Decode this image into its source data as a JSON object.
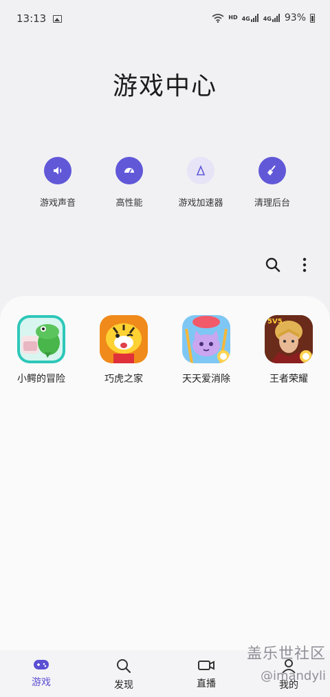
{
  "status_bar": {
    "time": "13:13",
    "hd": "HD",
    "network1": "4G",
    "network2": "4G",
    "battery": "93%"
  },
  "title": "游戏中心",
  "quick_actions": [
    {
      "label": "游戏声音",
      "icon": "volume-icon"
    },
    {
      "label": "高性能",
      "icon": "performance-icon"
    },
    {
      "label": "游戏加速器",
      "icon": "accelerator-icon"
    },
    {
      "label": "清理后台",
      "icon": "broom-icon"
    }
  ],
  "games": [
    {
      "name": "小鳄的冒险",
      "icon": "crocodile-game-icon"
    },
    {
      "name": "巧虎之家",
      "icon": "tiger-game-icon"
    },
    {
      "name": "天天爱消除",
      "icon": "cat-game-icon"
    },
    {
      "name": "王者荣耀",
      "icon": "hero-game-icon",
      "badge": "5V5"
    }
  ],
  "bottom_nav": [
    {
      "label": "游戏",
      "icon": "gamepad-icon",
      "active": true
    },
    {
      "label": "发现",
      "icon": "search-icon",
      "active": false
    },
    {
      "label": "直播",
      "icon": "video-camera-icon",
      "active": false
    },
    {
      "label": "我的",
      "icon": "person-icon",
      "active": false
    }
  ],
  "watermark": {
    "line1": "盖乐世社区",
    "line2": "@imandyli"
  },
  "colors": {
    "accent": "#6158d8",
    "background": "#f1f1f3",
    "panel": "#fafafa"
  }
}
